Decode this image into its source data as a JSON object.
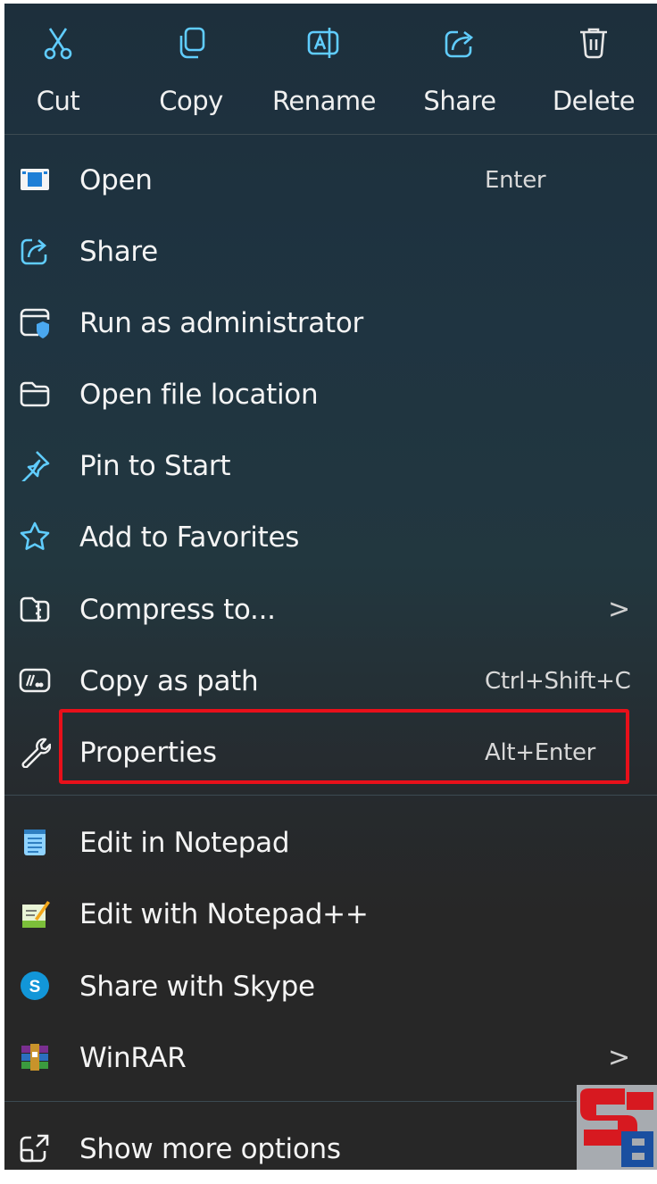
{
  "toolbar": [
    {
      "label": "Cut",
      "icon": "scissors-icon"
    },
    {
      "label": "Copy",
      "icon": "copy-icon"
    },
    {
      "label": "Rename",
      "icon": "rename-icon"
    },
    {
      "label": "Share",
      "icon": "share-icon"
    },
    {
      "label": "Delete",
      "icon": "trash-icon"
    }
  ],
  "items": [
    {
      "label": "Open",
      "shortcut": "Enter",
      "icon": "window-icon"
    },
    {
      "label": "Share",
      "icon": "share-icon"
    },
    {
      "label": "Run as administrator",
      "icon": "shield-window-icon"
    },
    {
      "label": "Open file location",
      "icon": "folder-icon"
    },
    {
      "label": "Pin to Start",
      "icon": "pin-icon"
    },
    {
      "label": "Add to Favorites",
      "icon": "star-icon"
    },
    {
      "label": "Compress to...",
      "icon": "zip-folder-icon",
      "submenu": true
    },
    {
      "label": "Copy as path",
      "shortcut": "Ctrl+Shift+C",
      "icon": "path-icon"
    },
    {
      "label": "Properties",
      "shortcut": "Alt+Enter",
      "icon": "wrench-icon",
      "highlighted": true
    },
    {
      "label": "Edit in Notepad",
      "icon": "notepad-icon"
    },
    {
      "label": "Edit with Notepad++",
      "icon": "notepadpp-icon"
    },
    {
      "label": "Share with Skype",
      "icon": "skype-icon"
    },
    {
      "label": "WinRAR",
      "icon": "winrar-icon",
      "submenu": true
    },
    {
      "label": "Show more options",
      "icon": "more-options-icon"
    }
  ],
  "submenu_glyph": ">",
  "colors": {
    "accent": "#60cdff",
    "highlight_border": "#e8101a",
    "menu_bg": "#272727"
  }
}
